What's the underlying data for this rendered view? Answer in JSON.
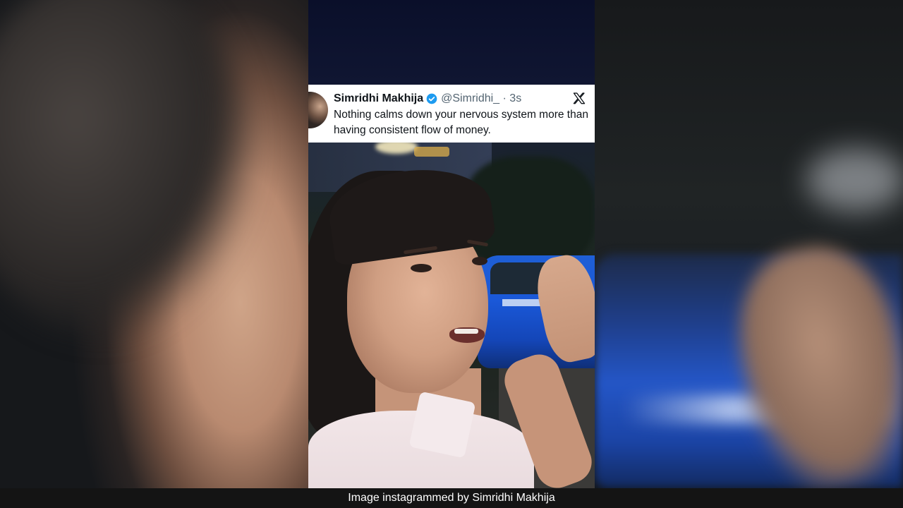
{
  "tweet": {
    "display_name": "Simridhi Makhija",
    "handle_time": "@Simridhi_ · 3s",
    "text": "Nothing calms down your nervous system more than having consistent flow of money.",
    "verified": true,
    "platform_icon": "x-logo-icon"
  },
  "caption": {
    "text": "Image instagrammed by Simridhi Makhija"
  },
  "colors": {
    "verified_badge": "#1d9bf0",
    "tweet_background": "#ffffff",
    "caption_bar": "#141414"
  }
}
